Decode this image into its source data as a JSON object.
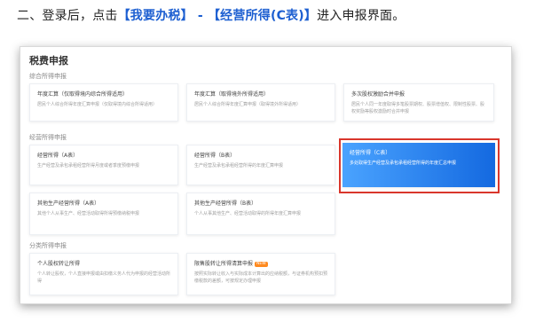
{
  "instruction": {
    "prefix": "二、登录后，点击",
    "hl1": "【我要办税】",
    "dash": " - ",
    "hl2": "【经营所得(C表)】",
    "suffix": "进入申报界面。"
  },
  "panel": {
    "title": "税费申报",
    "sections": [
      {
        "label": "综合所得申报",
        "cards": [
          {
            "title": "年度汇算（仅取得境内综合所得适用）",
            "desc": "居民个人综合所得年度汇算申报（仅取得境内综合所得适用）"
          },
          {
            "title": "年度汇算（取得境外所得适用）",
            "desc": "居民个人综合所得年度汇算申报（取得境外所得适用）"
          },
          {
            "title": "多次股权激励合并申报",
            "desc": "居民个人同一年度取得多笔股票期权、股票增值权、限制性股票、股权奖励等股权激励时合并申报"
          }
        ]
      },
      {
        "label": "经营所得申报",
        "cards": [
          {
            "title": "经营所得（A表）",
            "desc": "生产经营及承包承租经营所得月度或者季度预缴申报"
          },
          {
            "title": "经营所得（B表）",
            "desc": "生产经营及承包承租经营所得的年度汇算申报"
          },
          {
            "title": "经营所得（C表）",
            "desc": "多处取得生产经营及承包承租经营所得的年度汇总申报"
          },
          {
            "title": "其他生产经营所得（A表）",
            "desc": "其他个人从事生产、经营活动取得所得预缴纳税申报"
          },
          {
            "title": "其他生产经营所得（B表）",
            "desc": "个人从事其他生产、经营活动取得的所得年度汇算申报"
          }
        ]
      },
      {
        "label": "分类所得申报",
        "cards": [
          {
            "title": "个人股权转让所得",
            "desc": "个人转让股权，个人直接申报或由扣缴义务人代为申报的经营活动所得"
          },
          {
            "title": "限售股转让所得清算申报",
            "badge": "NEW",
            "desc": "按照实际转让收入与实际成本计算出的应纳税额，与证券机构预扣预缴税款的差额，可按规定办理申报"
          }
        ]
      }
    ]
  },
  "colors": {
    "accent": "#1d5fd1",
    "active_card": "#2a83f0",
    "highlight_box": "#d9362c",
    "badge": "#ff8a1f"
  }
}
